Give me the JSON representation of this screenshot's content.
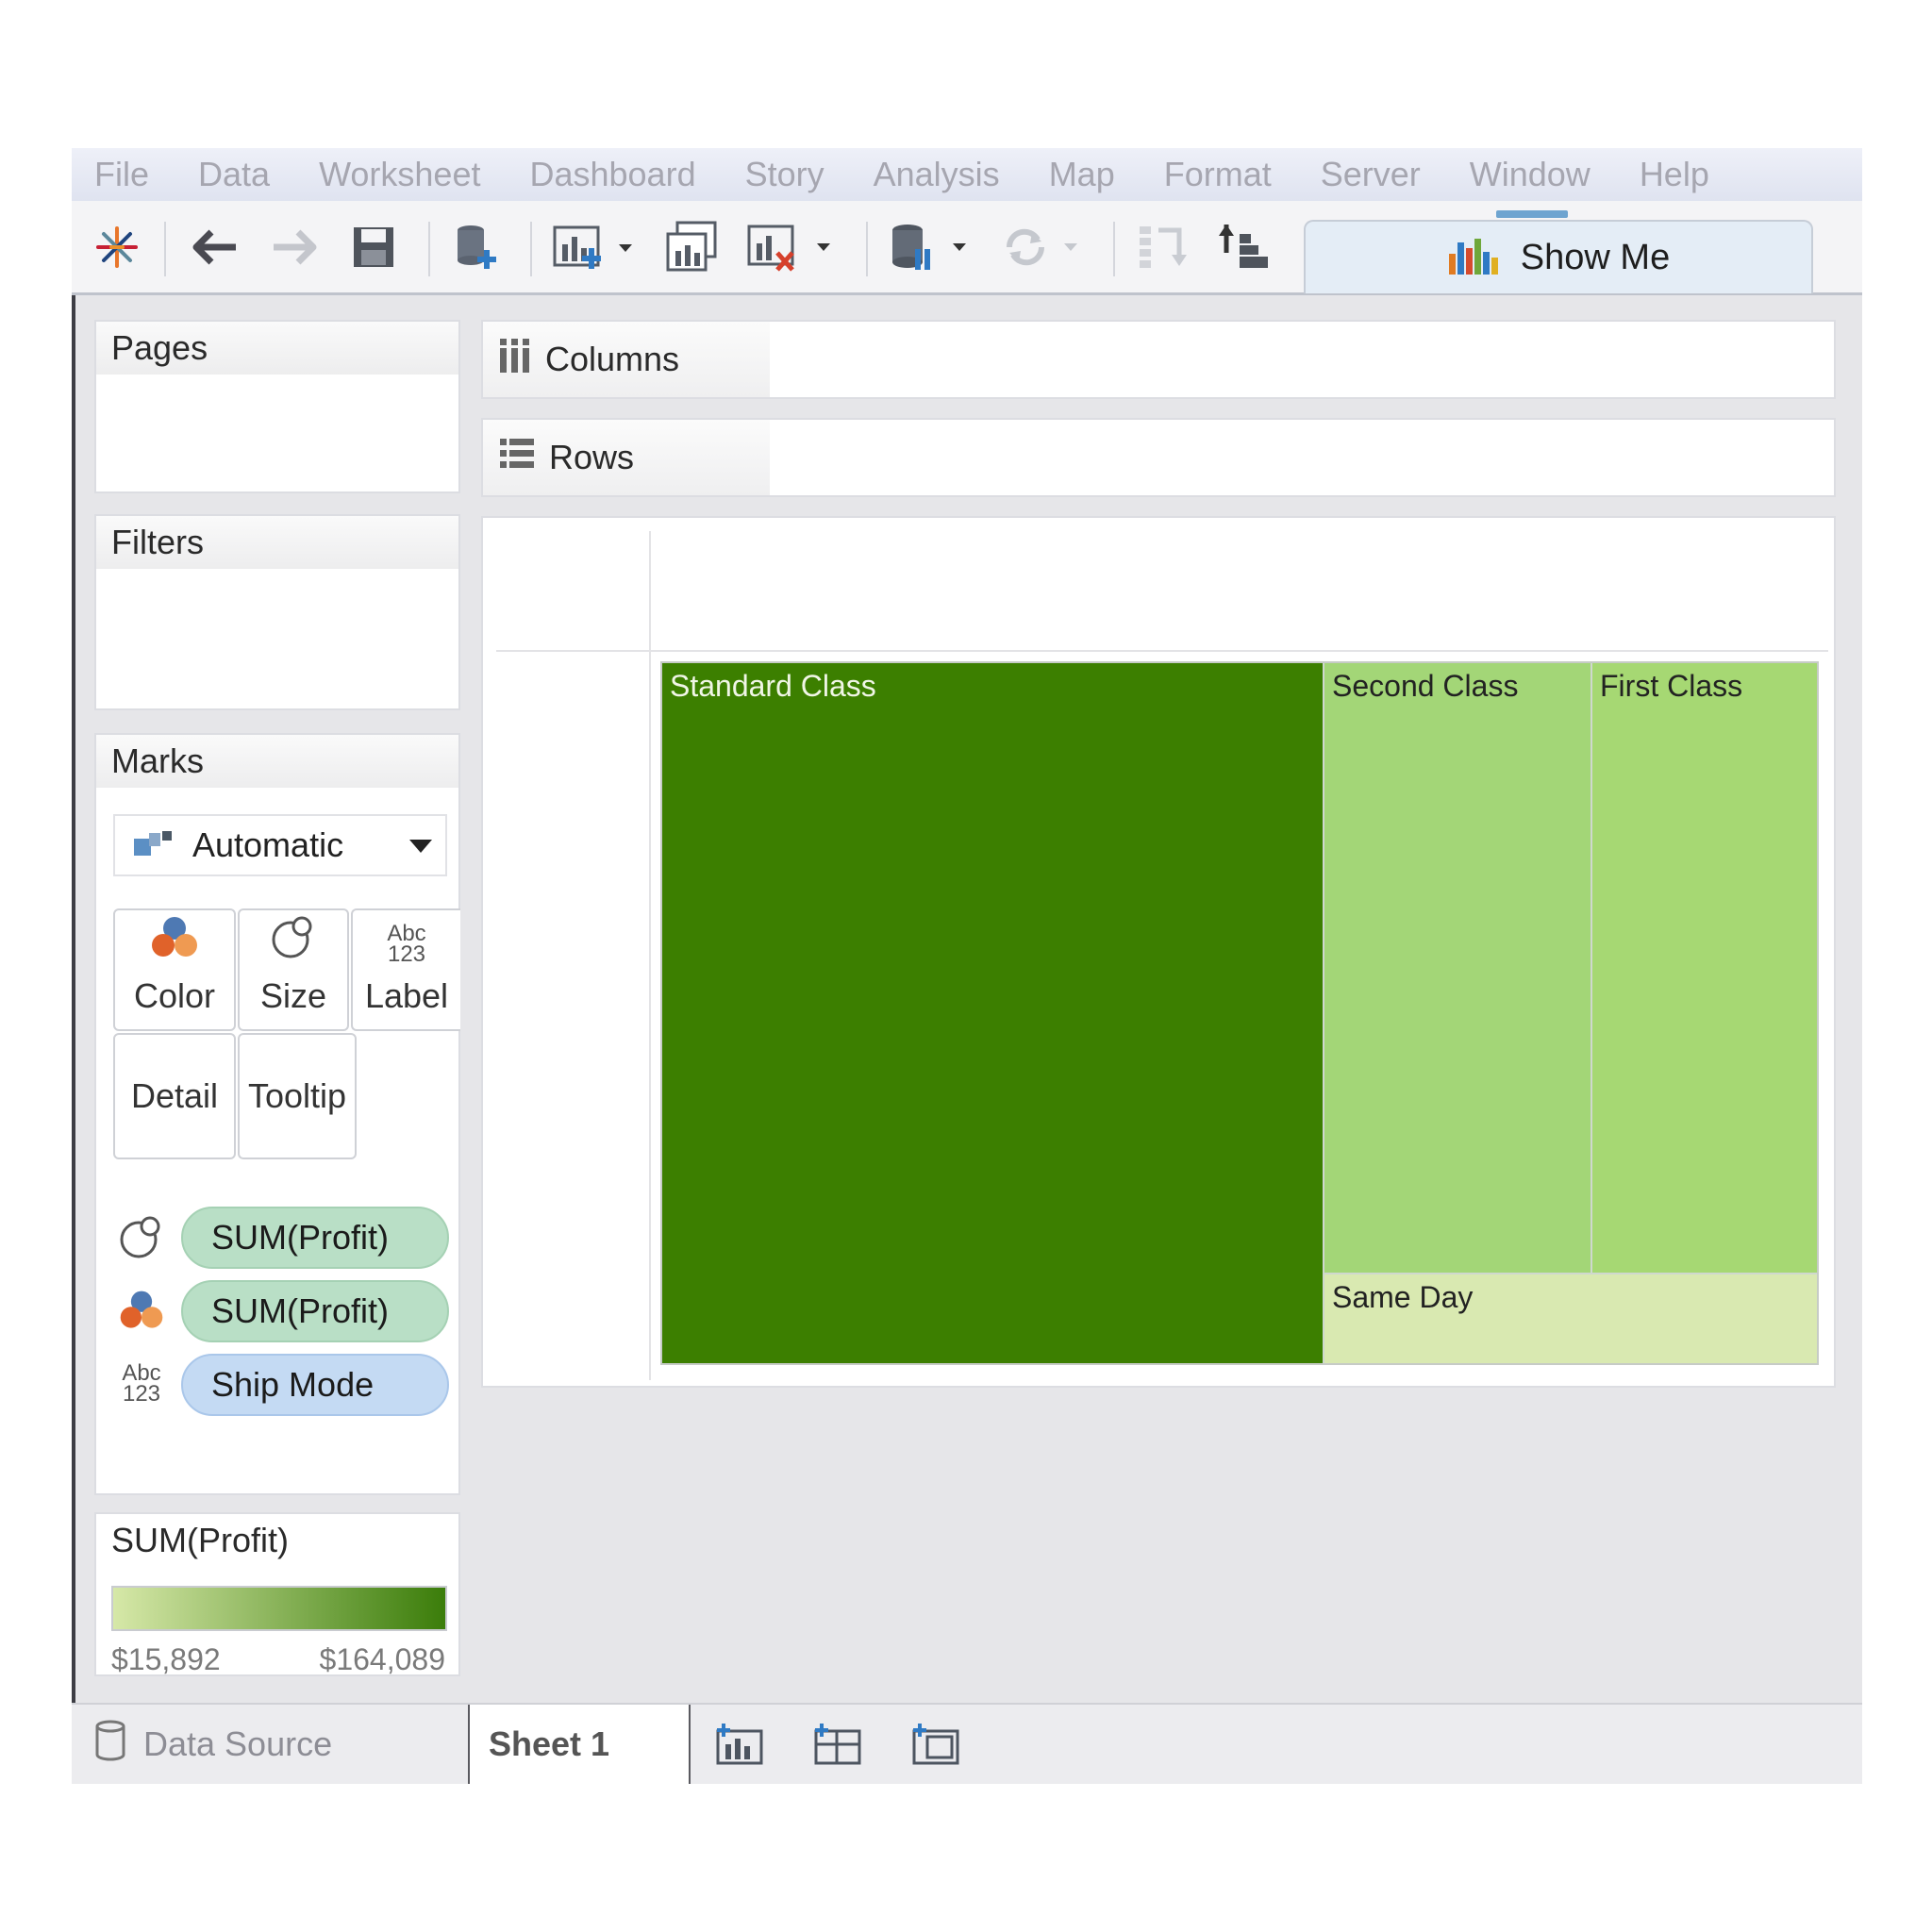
{
  "menu": [
    "File",
    "Data",
    "Worksheet",
    "Dashboard",
    "Story",
    "Analysis",
    "Map",
    "Format",
    "Server",
    "Window",
    "Help"
  ],
  "toolbar": {
    "show_me_label": "Show Me",
    "icons": [
      "tableau-logo-icon",
      "undo-icon",
      "redo-icon",
      "save-icon",
      "new-data-source-icon",
      "new-worksheet-icon",
      "duplicate-sheet-icon",
      "clear-sheet-icon",
      "pause-updates-icon",
      "refresh-icon",
      "swap-icon",
      "sort-icon"
    ]
  },
  "cards": {
    "pages": "Pages",
    "filters": "Filters",
    "marks": "Marks",
    "mark_type": "Automatic",
    "buttons": {
      "color": "Color",
      "size": "Size",
      "label": "Label",
      "detail": "Detail",
      "tooltip": "Tooltip"
    },
    "pills": [
      {
        "kind": "size",
        "text": "SUM(Profit)"
      },
      {
        "kind": "color",
        "text": "SUM(Profit)"
      },
      {
        "kind": "label",
        "text": "Ship Mode"
      }
    ]
  },
  "legend": {
    "title": "SUM(Profit)",
    "min_label": "$15,892",
    "max_label": "$164,089",
    "color_low": "#d6e8a8",
    "color_high": "#3b7d0a"
  },
  "shelves": {
    "columns": "Columns",
    "rows": "Rows"
  },
  "treemap": {
    "tiles": [
      {
        "name": "Standard Class",
        "color": "#3c7f00",
        "text_color": "#f0f6e6"
      },
      {
        "name": "Second Class",
        "color": "#a3d677",
        "text_color": "#222222"
      },
      {
        "name": "First Class",
        "color": "#a6d873",
        "text_color": "#222222"
      },
      {
        "name": "Same Day",
        "color": "#d9e9b1",
        "text_color": "#222222"
      }
    ]
  },
  "tabs": {
    "data_source": "Data Source",
    "sheet": "Sheet 1"
  }
}
